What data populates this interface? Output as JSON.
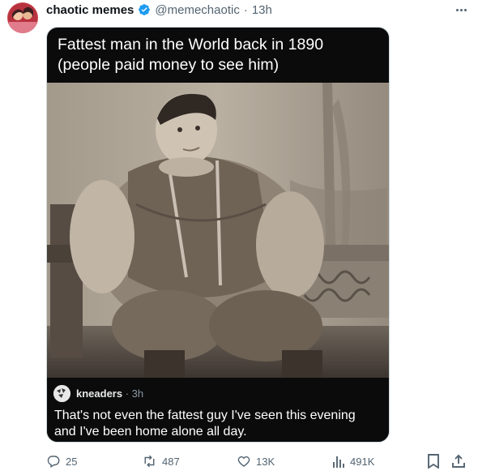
{
  "post": {
    "display_name": "chaotic memes",
    "handle": "@memechaotic",
    "separator": "·",
    "time": "13h"
  },
  "media": {
    "caption_line1": "Fattest man in the World back in 1890",
    "caption_line2": "(people paid money to see him)",
    "comment": {
      "username": "kneaders",
      "meta": "· 3h",
      "text_line1": "That's not even the fattest guy I've seen this evening",
      "text_line2": "and I've been home alone all day."
    }
  },
  "actions": {
    "replies": "25",
    "reposts": "487",
    "likes": "13K",
    "views": "491K"
  },
  "colors": {
    "text_primary": "#0f1419",
    "text_secondary": "#536471",
    "verified": "#1d9bf0",
    "media_bg": "#0b0b0b"
  },
  "icons": [
    "verified-badge-icon",
    "more-icon",
    "reply-icon",
    "repost-icon",
    "like-icon",
    "views-icon",
    "bookmark-icon",
    "share-icon"
  ]
}
